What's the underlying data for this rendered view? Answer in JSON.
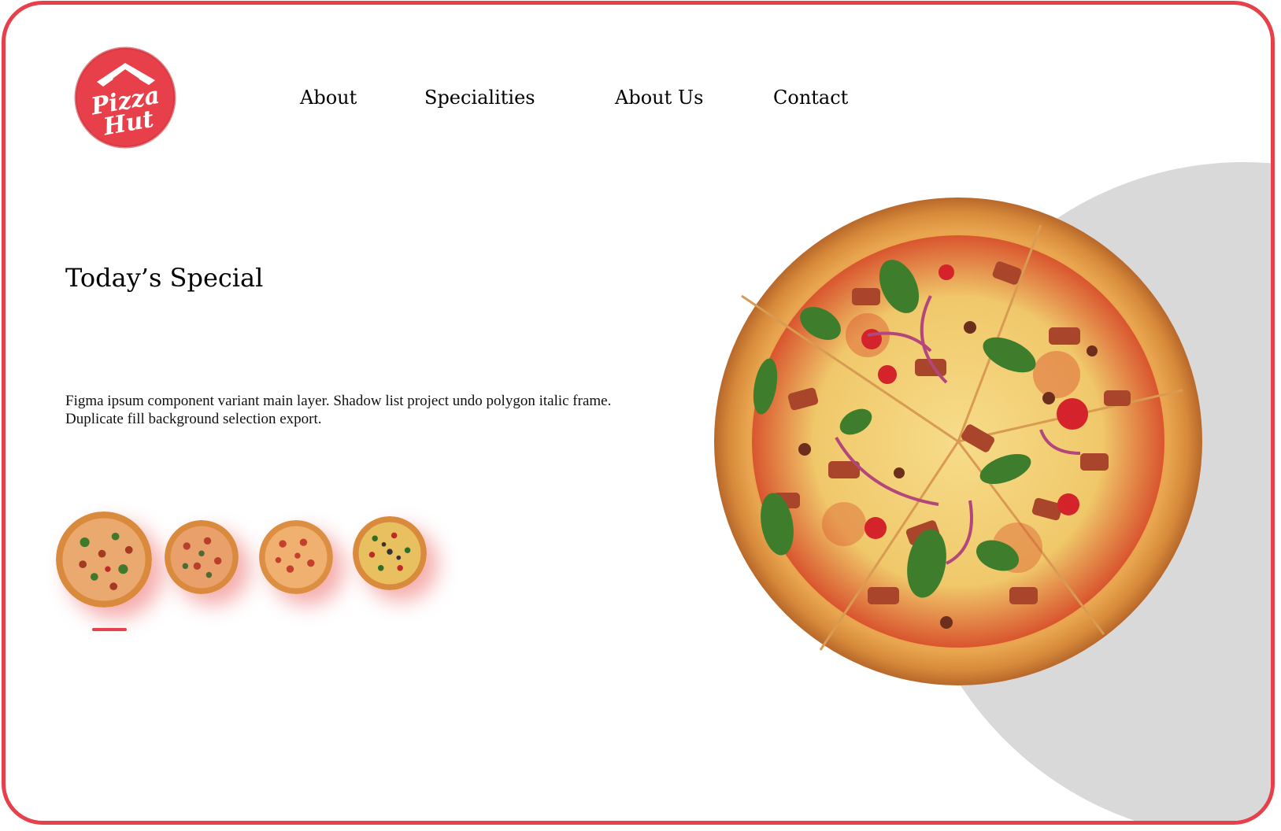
{
  "brand": {
    "logo_text_line1": "Pizza",
    "logo_text_line2": "Hut",
    "accent_color": "#e8404a"
  },
  "nav": {
    "items": [
      {
        "label": "About"
      },
      {
        "label": "Specialities"
      },
      {
        "label": "About Us"
      },
      {
        "label": "Contact"
      }
    ]
  },
  "hero": {
    "title": "Today’s Special",
    "description": "Figma ipsum component variant main layer. Shadow list project undo polygon italic frame. Duplicate fill background selection export."
  },
  "carousel": {
    "selected_index": 0,
    "thumbnails": [
      {
        "icon": "pizza-thumbnail-icon"
      },
      {
        "icon": "pizza-thumbnail-icon"
      },
      {
        "icon": "pizza-thumbnail-icon"
      },
      {
        "icon": "pizza-thumbnail-icon"
      }
    ]
  },
  "featured": {
    "icon": "pizza-image"
  }
}
